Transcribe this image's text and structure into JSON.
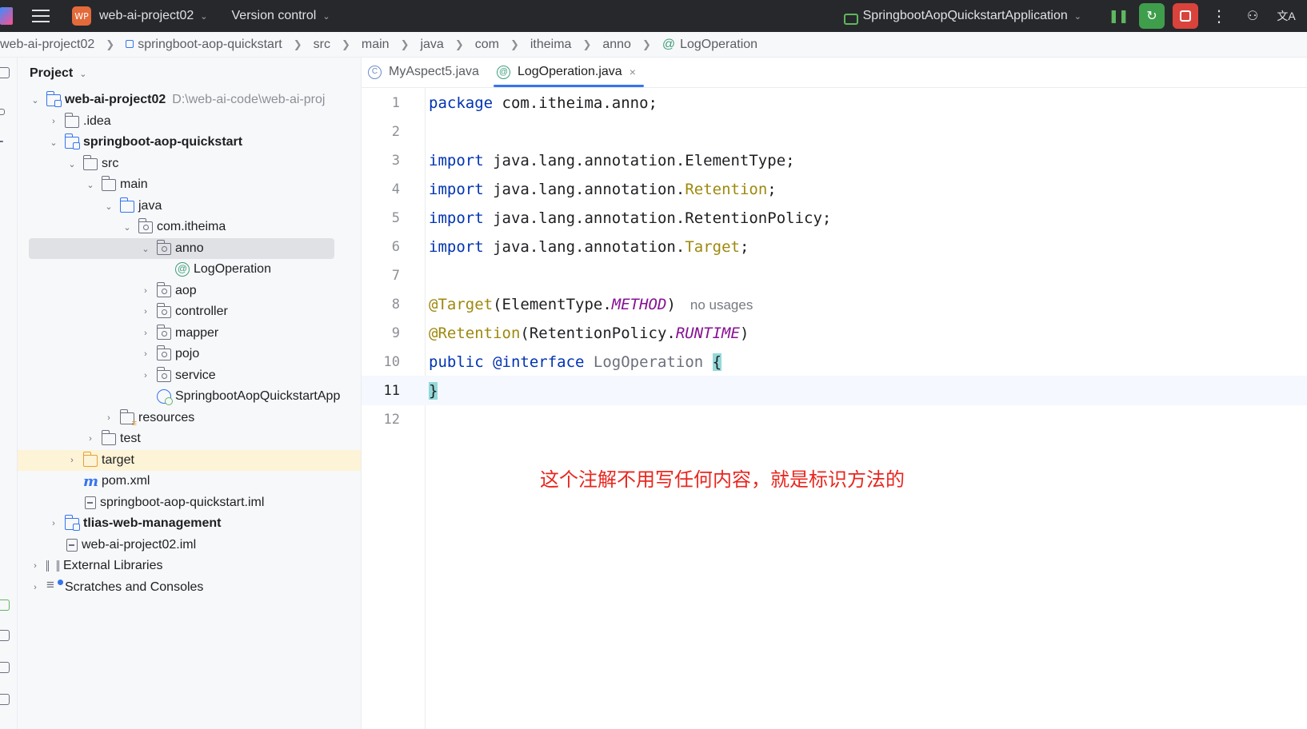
{
  "titlebar": {
    "project_badge": "WP",
    "project_name": "web-ai-project02",
    "version_control": "Version control",
    "run_config": "SpringbootAopQuickstartApplication",
    "more_glyph": "⋮",
    "user_glyph": "⚇",
    "translate_glyph": "文A"
  },
  "breadcrumb": [
    "web-ai-project02",
    "springboot-aop-quickstart",
    "src",
    "main",
    "java",
    "com",
    "itheima",
    "anno",
    "LogOperation"
  ],
  "project": {
    "title": "Project",
    "tree": [
      {
        "label": "web-ai-project02",
        "hint": "D:\\web-ai-code\\web-ai-proj",
        "bold": true,
        "expanded": true
      },
      {
        "label": ".idea"
      },
      {
        "label": "springboot-aop-quickstart",
        "bold": true,
        "expanded": true
      },
      {
        "label": "src",
        "expanded": true
      },
      {
        "label": "main",
        "expanded": true
      },
      {
        "label": "java",
        "expanded": true
      },
      {
        "label": "com.itheima",
        "expanded": true
      },
      {
        "label": "anno",
        "expanded": true,
        "selected": true
      },
      {
        "label": "LogOperation"
      },
      {
        "label": "aop"
      },
      {
        "label": "controller"
      },
      {
        "label": "mapper"
      },
      {
        "label": "pojo"
      },
      {
        "label": "service"
      },
      {
        "label": "SpringbootAopQuickstartApp"
      },
      {
        "label": "resources"
      },
      {
        "label": "test"
      },
      {
        "label": "target"
      },
      {
        "label": "pom.xml"
      },
      {
        "label": "springboot-aop-quickstart.iml"
      },
      {
        "label": "tlias-web-management",
        "bold": true
      },
      {
        "label": "web-ai-project02.iml"
      },
      {
        "label": "External Libraries"
      },
      {
        "label": "Scratches and Consoles"
      }
    ]
  },
  "tabs": [
    {
      "label": "MyAspect5.java",
      "active": false
    },
    {
      "label": "LogOperation.java",
      "active": true,
      "close": "×"
    }
  ],
  "code": {
    "line_numbers": [
      "1",
      "2",
      "3",
      "4",
      "5",
      "6",
      "7",
      "8",
      "9",
      "10",
      "11",
      "12"
    ],
    "current_line": 11,
    "lines": {
      "l1": [
        "package",
        " com.itheima.anno;"
      ],
      "l3": [
        "import",
        " java.lang.annotation.ElementType;"
      ],
      "l4": [
        "import",
        " java.lang.annotation.",
        "Retention",
        ";"
      ],
      "l5": [
        "import",
        " java.lang.annotation.RetentionPolicy;"
      ],
      "l6": [
        "import",
        " java.lang.annotation.",
        "Target",
        ";"
      ],
      "l8": [
        "@Target",
        "(ElementType.",
        "METHOD",
        ")",
        "no usages"
      ],
      "l9": [
        "@Retention",
        "(RetentionPolicy.",
        "RUNTIME",
        ")"
      ],
      "l10": [
        "public",
        " @",
        "interface",
        " LogOperation ",
        "{"
      ],
      "l11": [
        "}"
      ]
    }
  },
  "caption": "这个注解不用写任何内容，就是标识方法的",
  "colors": {
    "titlebar_bg": "#27282c",
    "keyword": "#0033b3",
    "annotation": "#9e880d",
    "constant": "#871094",
    "caption": "#e8271f",
    "accent": "#3574f0"
  }
}
